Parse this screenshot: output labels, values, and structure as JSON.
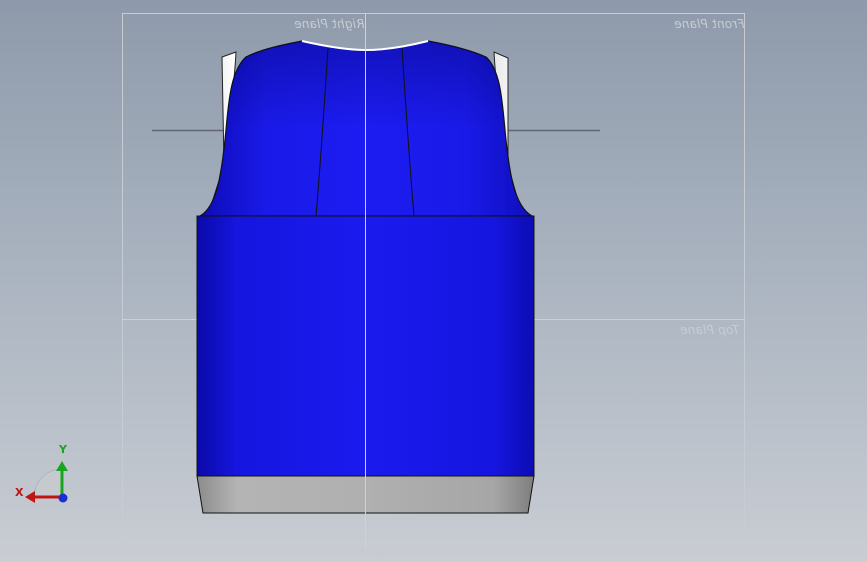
{
  "viewport": {
    "planes": {
      "right": "Right Plane",
      "front": "Front Plane",
      "top": "Top Plane"
    }
  },
  "triad": {
    "x_label": "X",
    "y_label": "Y",
    "x_color": "#c01515",
    "y_color": "#19a51f",
    "z_color": "#1a2fd0"
  },
  "model": {
    "body_color": "#1414e6",
    "hem_color": "#a8a8a8",
    "outline_color": "#111111"
  }
}
